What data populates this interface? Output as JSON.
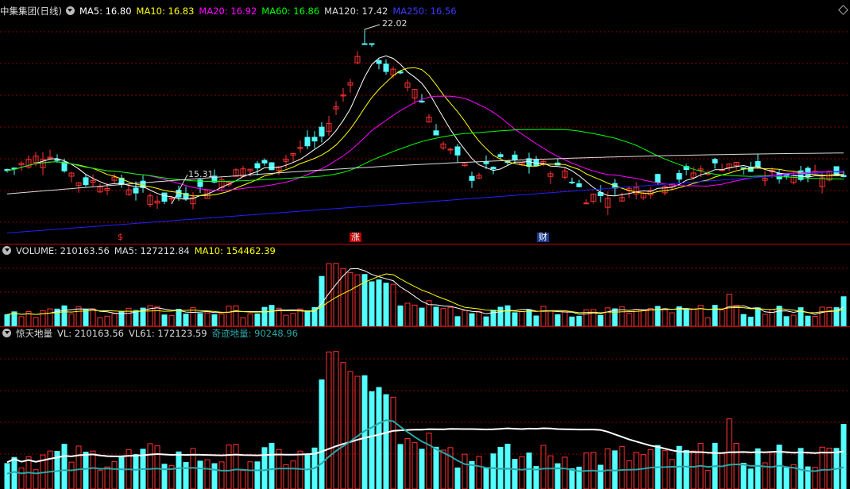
{
  "main_legend": {
    "title": "中集集团(日线)",
    "ma5": "MA5: 16.80",
    "ma10": "MA10: 16.83",
    "ma20": "MA20: 16.92",
    "ma60": "MA60: 16.86",
    "ma120": "MA120: 17.42",
    "ma250": "MA250: 16.56"
  },
  "price_annotations": {
    "high": "22.02",
    "low": "15.31"
  },
  "event_markers": [
    {
      "label": "$",
      "color": "#ff3030",
      "bg": "#000000"
    },
    {
      "label": "涨",
      "color": "#ffffff",
      "bg": "#c00000"
    },
    {
      "label": "财",
      "color": "#ffffff",
      "bg": "#1a3a8a"
    }
  ],
  "volume_legend": {
    "title": "VOLUME: 210163.56",
    "ma5": "MA5: 127212.84",
    "ma10": "MA10: 154462.39"
  },
  "indicator_legend": {
    "title": "惊天地量",
    "vl": "VL: 210163.56",
    "vl61": "VL61: 172123.59",
    "qiji": "奇迹地量: 90248.96"
  },
  "colors": {
    "up": "#ff3232",
    "down": "#54ffff",
    "grid": "#8b0000",
    "ma5": "#ffffff",
    "ma10": "#ffff00",
    "ma20": "#ff00ff",
    "ma60": "#00ff00",
    "ma120": "#dddddd",
    "ma250": "#2020ff"
  },
  "chart_data": {
    "type": "candlestick",
    "price_high_label": "22.02",
    "price_low_label": "15.31",
    "ma_values": {
      "MA5": 16.8,
      "MA10": 16.83,
      "MA20": 16.92,
      "MA60": 16.86,
      "MA120": 17.42,
      "MA250": 16.56
    },
    "latest_volume": 210163.56
  }
}
